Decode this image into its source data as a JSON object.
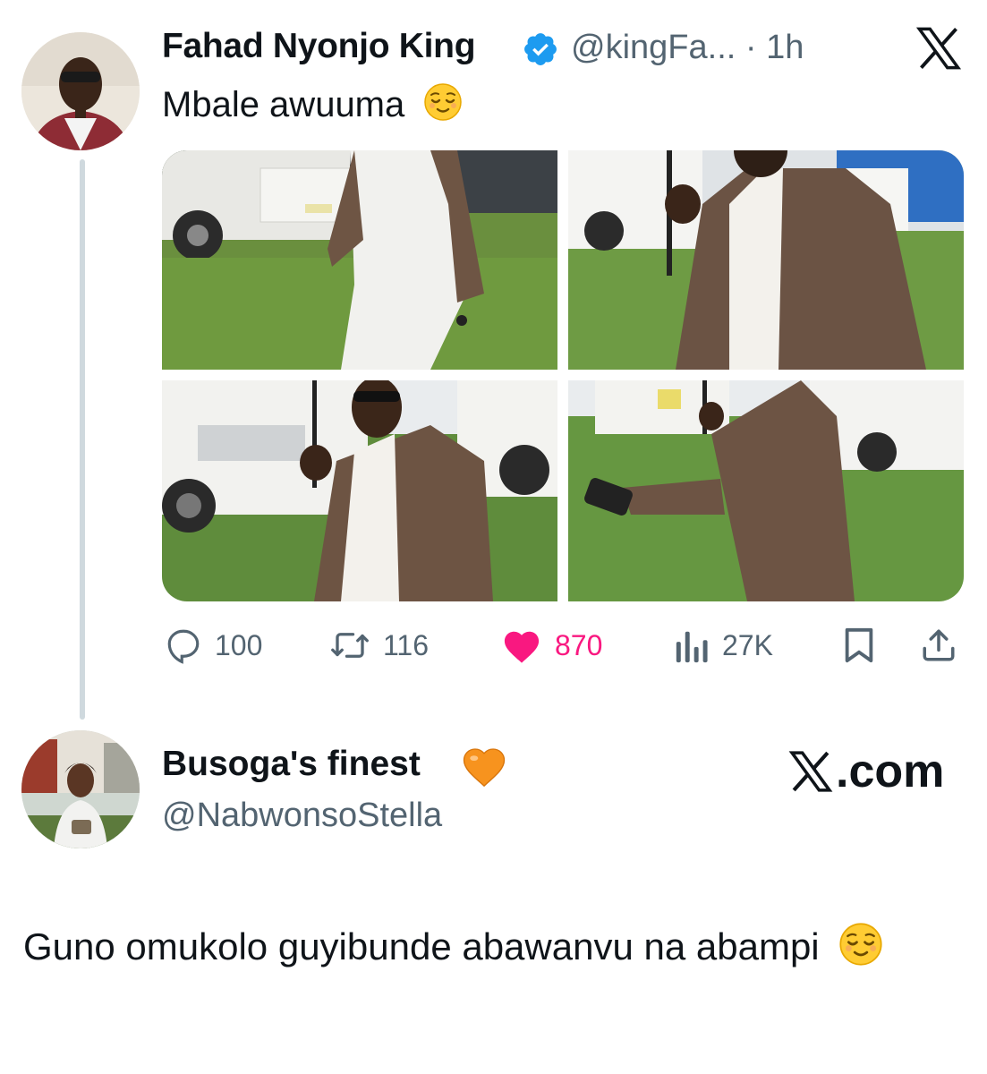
{
  "tweet": {
    "author_name": "Fahad Nyonjo King",
    "handle_time": "@kingFa... · 1h",
    "text": "Mbale awuuma",
    "images": [
      {
        "alt": "man in plaid blazer walking on grass near truck"
      },
      {
        "alt": "man in plaid blazer holding umbrella beside white SUV"
      },
      {
        "alt": "smiling man with umbrella in front of white SUV"
      },
      {
        "alt": "man in plaid blazer holding phone near white cars"
      }
    ],
    "stats": {
      "replies": "100",
      "retweets": "116",
      "likes": "870",
      "views": "27K"
    }
  },
  "quote": {
    "author_name": "Busoga's finest",
    "handle": "@NabwonsoStella",
    "site": ".com",
    "text": "Guno omukolo guyibunde abawanvu na abampi"
  },
  "colors": {
    "like": "#f91880",
    "verified": "#1d9bf0",
    "secondary_text": "#536471",
    "thread_line": "#cfd9de"
  },
  "icons": [
    "verified-badge-icon",
    "x-logo-icon",
    "relieved-face-emoji",
    "reply-icon",
    "retweet-icon",
    "heart-icon",
    "views-icon",
    "bookmark-icon",
    "share-icon",
    "orange-heart-emoji"
  ]
}
